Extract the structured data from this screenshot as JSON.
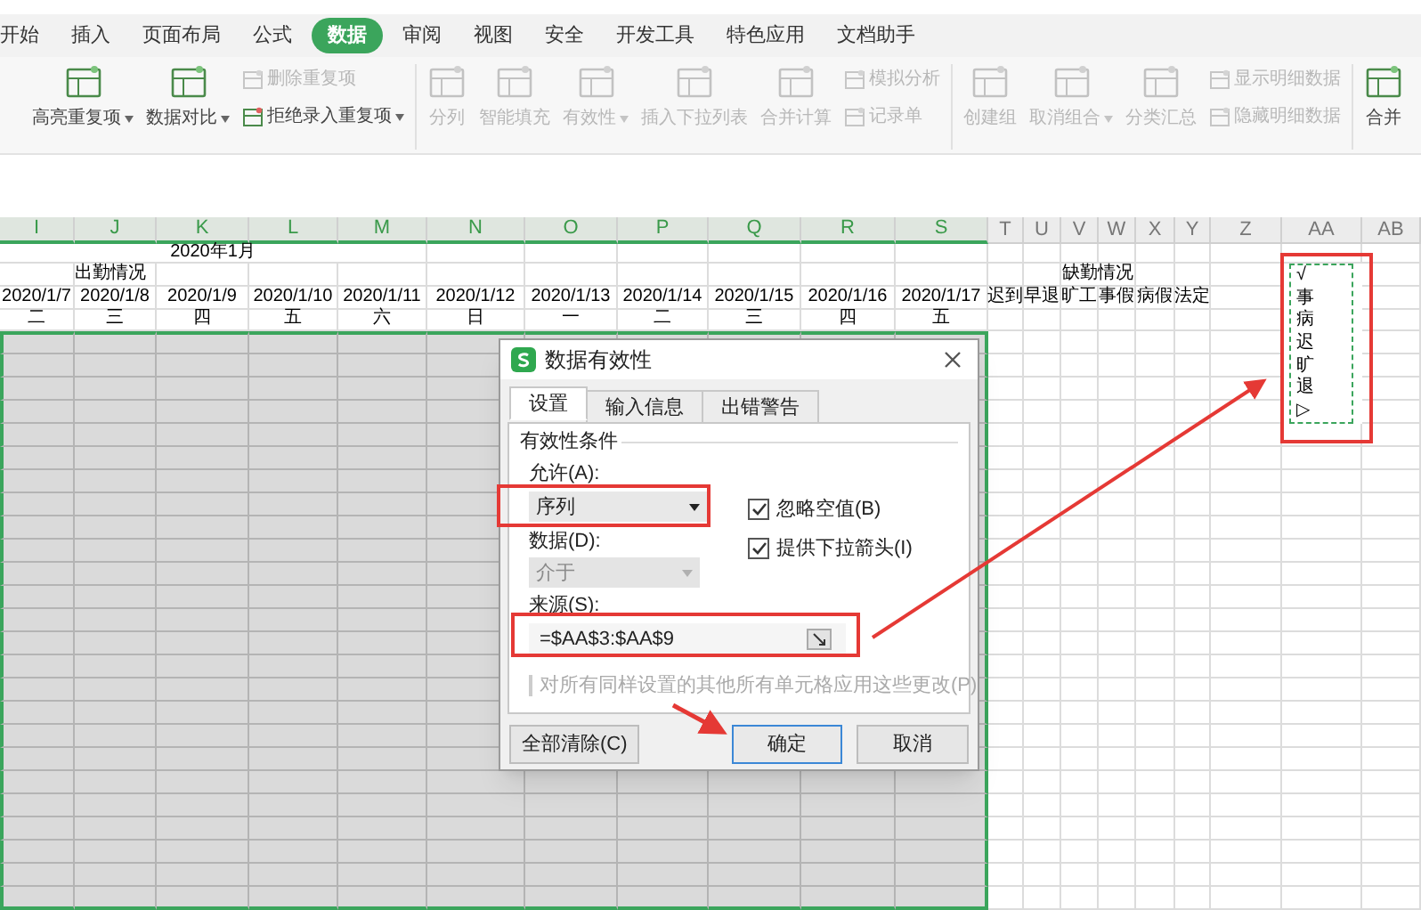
{
  "menu_tabs": [
    {
      "label": "开始",
      "selected": false
    },
    {
      "label": "插入",
      "selected": false
    },
    {
      "label": "页面布局",
      "selected": false
    },
    {
      "label": "公式",
      "selected": false
    },
    {
      "label": "数据",
      "selected": true
    },
    {
      "label": "审阅",
      "selected": false
    },
    {
      "label": "视图",
      "selected": false
    },
    {
      "label": "安全",
      "selected": false
    },
    {
      "label": "开发工具",
      "selected": false
    },
    {
      "label": "特色应用",
      "selected": false
    },
    {
      "label": "文档助手",
      "selected": false
    }
  ],
  "ribbon": [
    [
      {
        "kind": "large",
        "label": "高亮重复项",
        "dropdown": true,
        "disabled": false
      },
      {
        "kind": "large",
        "label": "数据对比",
        "dropdown": true,
        "disabled": false
      },
      {
        "kind": "stack",
        "items": [
          {
            "label": "删除重复项",
            "dropdown": false,
            "disabled": true
          },
          {
            "label": "拒绝录入重复项",
            "dropdown": true,
            "disabled": false
          }
        ]
      }
    ],
    [
      {
        "kind": "large",
        "label": "分列",
        "dropdown": false,
        "disabled": true
      },
      {
        "kind": "large",
        "label": "智能填充",
        "dropdown": false,
        "disabled": true
      },
      {
        "kind": "large",
        "label": "有效性",
        "dropdown": true,
        "disabled": true
      },
      {
        "kind": "large",
        "label": "插入下拉列表",
        "dropdown": false,
        "disabled": true
      },
      {
        "kind": "large",
        "label": "合并计算",
        "dropdown": false,
        "disabled": true
      },
      {
        "kind": "stack",
        "items": [
          {
            "label": "模拟分析",
            "dropdown": false,
            "disabled": true
          },
          {
            "label": "记录单",
            "dropdown": false,
            "disabled": true
          }
        ]
      }
    ],
    [
      {
        "kind": "large",
        "label": "创建组",
        "dropdown": false,
        "disabled": true
      },
      {
        "kind": "large",
        "label": "取消组合",
        "dropdown": true,
        "disabled": true
      },
      {
        "kind": "large",
        "label": "分类汇总",
        "dropdown": false,
        "disabled": true
      },
      {
        "kind": "stack",
        "items": [
          {
            "label": "显示明细数据",
            "dropdown": false,
            "disabled": true
          },
          {
            "label": "隐藏明细数据",
            "dropdown": false,
            "disabled": true
          }
        ]
      }
    ],
    [
      {
        "kind": "large",
        "label": "合并",
        "dropdown": false,
        "disabled": false
      }
    ]
  ],
  "sheet": {
    "columns": [
      {
        "label": "I",
        "selected": true
      },
      {
        "label": "J",
        "selected": true
      },
      {
        "label": "K",
        "selected": true
      },
      {
        "label": "L",
        "selected": true
      },
      {
        "label": "M",
        "selected": true
      },
      {
        "label": "N",
        "selected": true
      },
      {
        "label": "O",
        "selected": true
      },
      {
        "label": "P",
        "selected": true
      },
      {
        "label": "Q",
        "selected": true
      },
      {
        "label": "R",
        "selected": true
      },
      {
        "label": "S",
        "selected": true
      },
      {
        "label": "T",
        "selected": false
      },
      {
        "label": "U",
        "selected": false
      },
      {
        "label": "V",
        "selected": false
      },
      {
        "label": "W",
        "selected": false
      },
      {
        "label": "X",
        "selected": false
      },
      {
        "label": "Y",
        "selected": false
      },
      {
        "label": "Z",
        "selected": false
      },
      {
        "label": "AA",
        "selected": false
      },
      {
        "label": "AB",
        "selected": false
      }
    ],
    "body_selected": true,
    "title": "2020年1月",
    "attendance_header": "出勤情况",
    "absence_header": "缺勤情况",
    "dates": [
      {
        "date": "2020/1/7",
        "weekday": "二"
      },
      {
        "date": "2020/1/8",
        "weekday": "三"
      },
      {
        "date": "2020/1/9",
        "weekday": "四"
      },
      {
        "date": "2020/1/10",
        "weekday": "五"
      },
      {
        "date": "2020/1/11",
        "weekday": "六"
      },
      {
        "date": "2020/1/12",
        "weekday": "日"
      },
      {
        "date": "2020/1/13",
        "weekday": "一"
      },
      {
        "date": "2020/1/14",
        "weekday": "二"
      },
      {
        "date": "2020/1/15",
        "weekday": "三"
      },
      {
        "date": "2020/1/16",
        "weekday": "四"
      },
      {
        "date": "2020/1/17",
        "weekday": "五"
      }
    ],
    "absence_types": [
      "迟到",
      "早退",
      "旷工",
      "事假",
      "病假",
      "法定"
    ],
    "list_values": [
      "√",
      "事",
      "病",
      "迟",
      "旷",
      "退",
      "▷"
    ]
  },
  "dialog": {
    "title": "数据有效性",
    "tabs": [
      {
        "label": "设置",
        "selected": true
      },
      {
        "label": "输入信息",
        "selected": false
      },
      {
        "label": "出错警告",
        "selected": false
      }
    ],
    "section": "有效性条件",
    "allow_label": "允许(A):",
    "allow_value": "序列",
    "ignore_blank": {
      "label": "忽略空值(B)",
      "checked": true
    },
    "dropdown_arrow": {
      "label": "提供下拉箭头(I)",
      "checked": true
    },
    "data_label": "数据(D):",
    "data_value": "介于",
    "data_disabled": true,
    "source_label": "来源(S):",
    "source_value": "=$AA$3:$AA$9",
    "apply_all": {
      "label": "对所有同样设置的其他所有单元格应用这些更改(P)",
      "checked": false,
      "disabled": true
    },
    "buttons": [
      {
        "kind": "clear",
        "label": "全部清除(C)",
        "focused": false
      },
      {
        "kind": "ok",
        "label": "确定",
        "focused": true
      },
      {
        "kind": "cancel",
        "label": "取消",
        "focused": false
      }
    ]
  }
}
